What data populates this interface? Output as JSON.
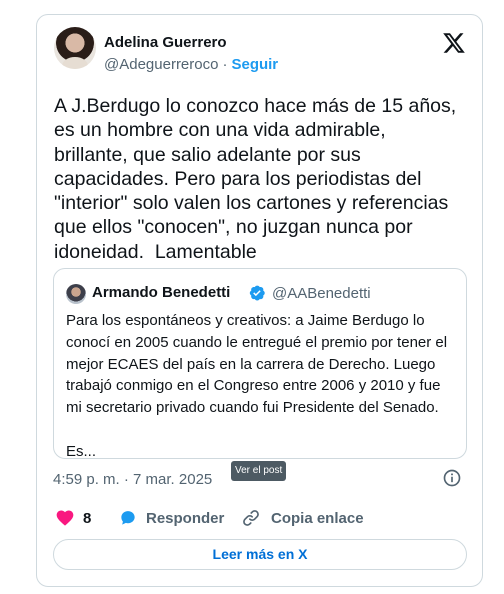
{
  "author": {
    "name": "Adelina Guerrero",
    "handle": "@Adeguerreroco",
    "separator": "·",
    "follow_label": "Seguir"
  },
  "brand_icon": "x-logo-icon",
  "tweet": {
    "text": "A J.Berdugo lo conozco hace más de 15 años,\nes un hombre con una vida admirable,\nbrillante, que salio adelante por sus\ncapacidades. Pero para los periodistas del\n\"interior\" solo valen los cartones y referencias\nque ellos \"conocen\", no juzgan nunca por\nidoneidad.  Lamentable"
  },
  "quoted": {
    "name": "Armando Benedetti",
    "handle": "@AABenedetti",
    "verified_icon": "verified-badge-icon",
    "text": "Para los espontáneos y creativos: a Jaime Berdugo lo\nconocí en 2005 cuando le entregué el premio por tener el\nmejor ECAES del país en la carrera de Derecho. Luego\ntrabajó conmigo en el Congreso entre 2006 y 2010 y fue\nmi secretario privado cuando fui Presidente del Senado.\n\nEs..."
  },
  "meta": {
    "timestamp": "4:59 p. m. · 7 mar. 2025",
    "tooltip": "Ver el post",
    "info_icon": "info-icon"
  },
  "actions": {
    "like_count": "8",
    "reply_label": "Responder",
    "copy_label": "Copia enlace"
  },
  "read_more_label": "Leer más en X",
  "colors": {
    "accent": "#1d9bf0",
    "link": "#006fd6",
    "like": "#f91880",
    "muted": "#536471",
    "border": "#cfd9de"
  }
}
